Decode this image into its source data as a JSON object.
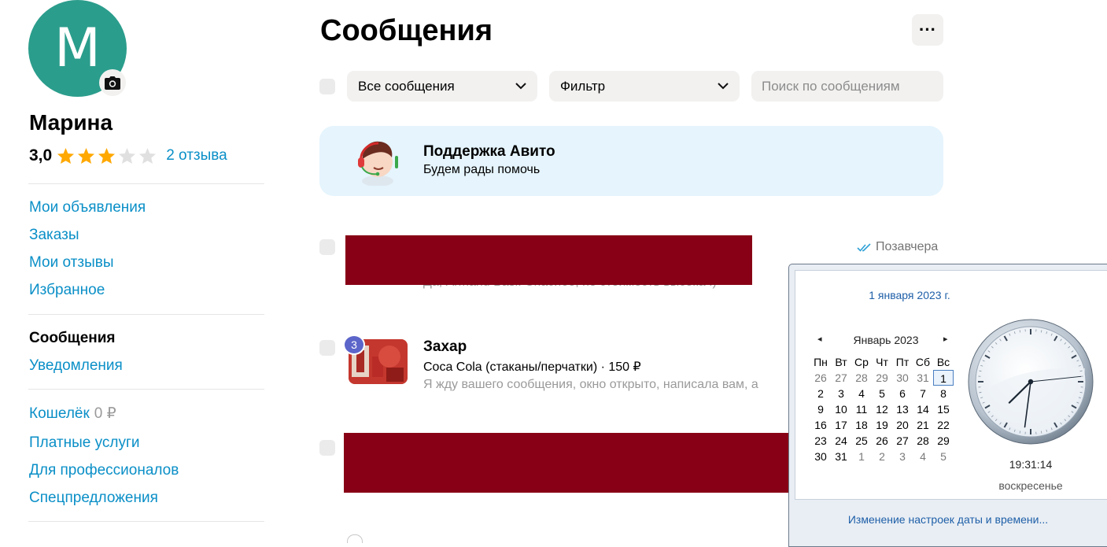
{
  "profile": {
    "initial": "M",
    "name": "Марина",
    "rating": "3,0",
    "stars_filled": 3,
    "stars_total": 5,
    "reviews_link": "2 отзыва"
  },
  "sidebar": {
    "group1": [
      "Мои объявления",
      "Заказы",
      "Мои отзывы",
      "Избранное"
    ],
    "group2_active": "Сообщения",
    "group2": [
      "Уведомления"
    ],
    "wallet": {
      "label": "Кошелёк",
      "amount": "0 ₽"
    },
    "group3": [
      "Платные услуги",
      "Для профессионалов",
      "Спецпредложения"
    ]
  },
  "main": {
    "title": "Сообщения",
    "more_label": "···",
    "filter_all": "Все сообщения",
    "filter": "Фильтр",
    "search_placeholder": "Поиск по сообщениям"
  },
  "support": {
    "title": "Поддержка Авито",
    "subtitle": "Будем рады помочь"
  },
  "messages": [
    {
      "time": "Позавчера",
      "preview_partial": "Да, Armand Basi. Спасибо, но стоимость высока :)"
    },
    {
      "unread": "3",
      "name": "Захар",
      "item": "Coca Cola (стаканы/перчатки) · 150 ₽",
      "preview": "Я жду вашего сообщения, окно открыто, написала вам, а"
    }
  ],
  "clock_flyout": {
    "date_long": "1 января 2023 г.",
    "month": "Январь 2023",
    "prev": "◂",
    "next": "▸",
    "weekdays": [
      "Пн",
      "Вт",
      "Ср",
      "Чт",
      "Пт",
      "Сб",
      "Вс"
    ],
    "weeks": [
      [
        "26",
        "27",
        "28",
        "29",
        "30",
        "31",
        "1"
      ],
      [
        "2",
        "3",
        "4",
        "5",
        "6",
        "7",
        "8"
      ],
      [
        "9",
        "10",
        "11",
        "12",
        "13",
        "14",
        "15"
      ],
      [
        "16",
        "17",
        "18",
        "19",
        "20",
        "21",
        "22"
      ],
      [
        "23",
        "24",
        "25",
        "26",
        "27",
        "28",
        "29"
      ],
      [
        "30",
        "31",
        "1",
        "2",
        "3",
        "4",
        "5"
      ]
    ],
    "today": "1",
    "time": "19:31:14",
    "hour": 19,
    "minute": 31,
    "second": 14,
    "weekday": "воскресенье",
    "footer_link": "Изменение настроек даты и времени..."
  },
  "colors": {
    "accent_link": "#0a8fc7",
    "avatar_bg": "#2b9d8c",
    "star_filled": "#ffa800",
    "star_empty": "#e0e0e0",
    "redaction": "#880015",
    "support_bg": "#e5f4fd",
    "unread_badge": "#5c65c9"
  },
  "icons": {
    "camera": "camera-icon",
    "chevron": "chevron-down-icon",
    "read_status": "double-check-icon",
    "support_agent": "support-agent-icon"
  }
}
